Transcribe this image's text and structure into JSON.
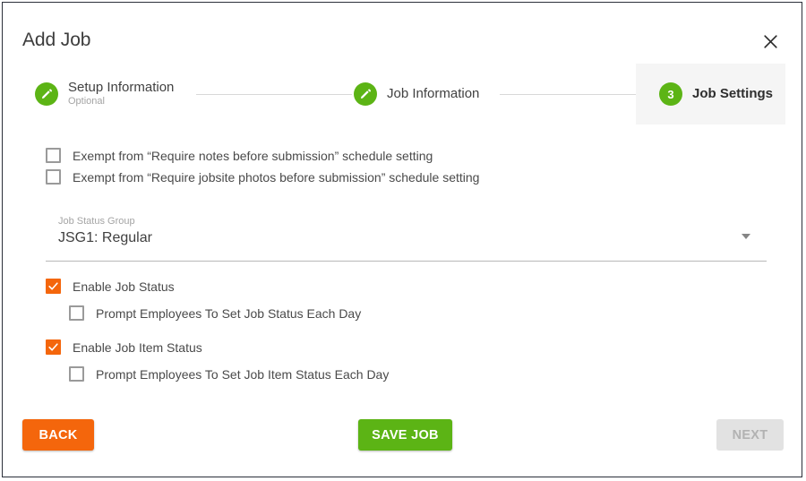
{
  "dialog": {
    "title": "Add Job",
    "close_icon": "close-icon"
  },
  "stepper": {
    "steps": [
      {
        "icon": "pencil-icon",
        "label": "Setup Information",
        "sublabel": "Optional",
        "state": "complete"
      },
      {
        "icon": "pencil-icon",
        "label": "Job Information",
        "sublabel": "",
        "state": "complete"
      },
      {
        "number": "3",
        "label": "Job Settings",
        "sublabel": "",
        "state": "active"
      }
    ]
  },
  "form": {
    "exempt_notes": {
      "label": "Exempt from “Require notes before submission” schedule setting",
      "checked": false
    },
    "exempt_photos": {
      "label": "Exempt from “Require jobsite photos before submission” schedule setting",
      "checked": false
    },
    "job_status_group": {
      "caption": "Job Status Group",
      "value": "JSG1: Regular",
      "arrow_icon": "chevron-down-icon"
    },
    "enable_job_status": {
      "label": "Enable Job Status",
      "checked": true
    },
    "prompt_job_status": {
      "label": "Prompt Employees To Set Job Status Each Day",
      "checked": false
    },
    "enable_job_item_status": {
      "label": "Enable Job Item Status",
      "checked": true
    },
    "prompt_job_item_status": {
      "label": "Prompt Employees To Set Job Item Status Each Day",
      "checked": false
    }
  },
  "footer": {
    "back_label": "BACK",
    "save_label": "SAVE JOB",
    "next_label": "NEXT",
    "next_disabled": true
  },
  "colors": {
    "green": "#5cb415",
    "orange": "#f4660c",
    "active_step_bg": "#f5f5f5",
    "disabled_bg": "#e2e2e2",
    "disabled_text": "#b2b2b2"
  }
}
